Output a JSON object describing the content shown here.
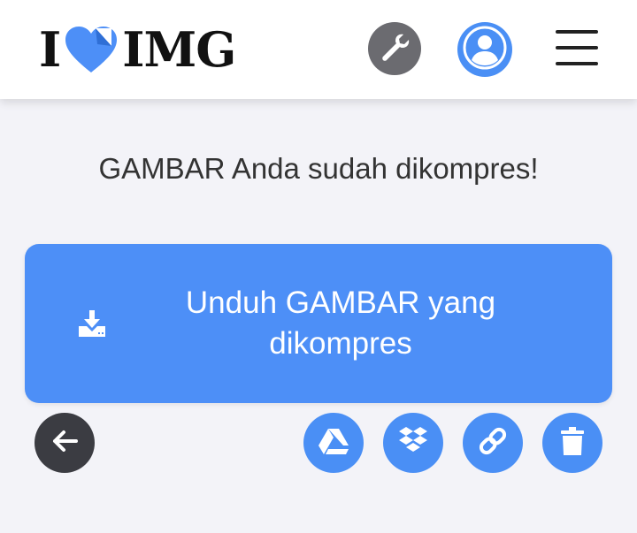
{
  "header": {
    "logo": {
      "prefix": "I",
      "suffix": "IMG"
    },
    "icons": {
      "tools": "wrench-icon",
      "user": "user-icon",
      "menu": "hamburger-menu-icon"
    }
  },
  "main": {
    "headline": "GAMBAR Anda sudah dikompres!",
    "download_button": {
      "label": "Unduh GAMBAR yang dikompres",
      "icon": "download-icon"
    },
    "actions": {
      "back": "arrow-left-icon",
      "drive": "google-drive-icon",
      "dropbox": "dropbox-icon",
      "link": "link-icon",
      "trash": "trash-icon"
    }
  },
  "colors": {
    "accent": "#4d8ff7",
    "dark_button": "#3b3c42",
    "tools_button": "#6b6b70",
    "background": "#f3f3f8"
  }
}
